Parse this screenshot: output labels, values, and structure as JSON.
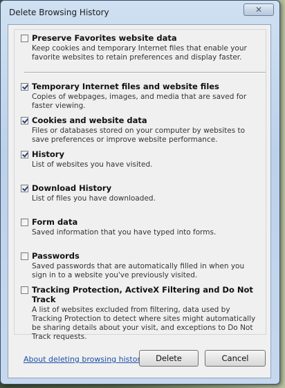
{
  "window": {
    "title": "Delete Browsing History",
    "close_glyph": "✕"
  },
  "items": [
    {
      "checked": false,
      "label": "Preserve Favorites website data",
      "desc": "Keep cookies and temporary Internet files that enable your favorite websites to retain preferences and display faster."
    },
    {
      "checked": true,
      "label": "Temporary Internet files and website files",
      "desc": "Copies of webpages, images, and media that are saved for faster viewing."
    },
    {
      "checked": true,
      "label": "Cookies and website data",
      "desc": "Files or databases stored on your computer by websites to save preferences or improve website performance."
    },
    {
      "checked": true,
      "label": "History",
      "desc": "List of websites you have visited."
    },
    {
      "checked": true,
      "label": "Download History",
      "desc": "List of files you have downloaded."
    },
    {
      "checked": false,
      "label": "Form data",
      "desc": "Saved information that you have typed into forms."
    },
    {
      "checked": false,
      "label": "Passwords",
      "desc": "Saved passwords that are automatically filled in when you sign in to a website you've previously visited."
    },
    {
      "checked": false,
      "label": "Tracking Protection, ActiveX Filtering and Do Not Track",
      "desc": "A list of websites excluded from filtering, data used by Tracking Protection to detect where sites might automatically be sharing details about your visit, and exceptions to Do Not Track requests."
    }
  ],
  "footer": {
    "about_link": "About deleting browsing history",
    "delete_label": "Delete",
    "cancel_label": "Cancel"
  }
}
